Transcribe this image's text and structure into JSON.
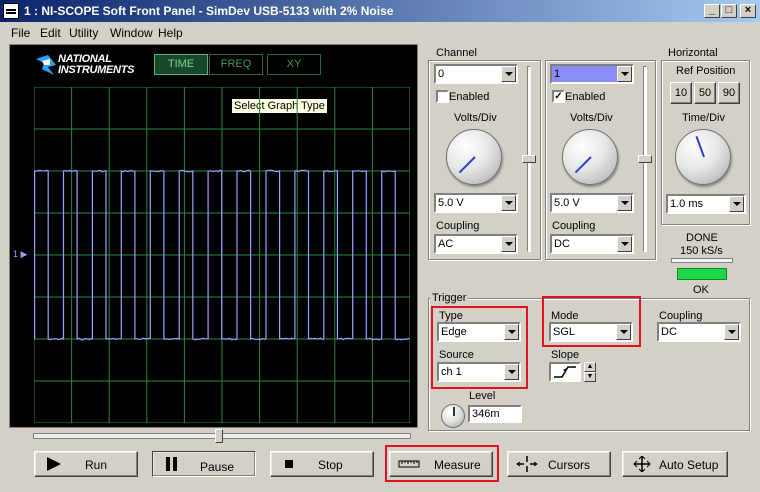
{
  "window": {
    "title": "1 : NI-SCOPE Soft Front Panel - SimDev USB-5133 with 2% Noise",
    "minimize": "_",
    "maximize": "□",
    "close": "×"
  },
  "menu": [
    "File",
    "Edit",
    "Utility",
    "Window",
    "Help"
  ],
  "graph": {
    "logo_line1": "NATIONAL",
    "logo_line2": "INSTRUMENTS",
    "tabs": [
      "TIME",
      "FREQ",
      "XY"
    ],
    "active_tab": "TIME",
    "tooltip": "Select Graph Type",
    "channel_marker": "1 ▶",
    "trace_color": "#9aa0ff",
    "grid_color": "#1f8a3e",
    "divisions": {
      "x": 10,
      "y": 8
    },
    "waveform": {
      "type": "square",
      "periods": 13,
      "high_level_div": 2.0,
      "low_level_div": -2.0,
      "duty": 0.47
    },
    "horizontal_scroll_fraction": 0.5
  },
  "channel": {
    "group_title": "Channel",
    "ch0": {
      "select": "0",
      "enabled_label": "Enabled",
      "enabled": false,
      "volts_label": "Volts/Div",
      "volts": "5.0 V",
      "coupling_label": "Coupling",
      "coupling": "AC",
      "offset_fraction": 0.5
    },
    "ch1": {
      "select": "1",
      "enabled_label": "Enabled",
      "enabled": true,
      "volts_label": "Volts/Div",
      "volts": "5.0 V",
      "coupling_label": "Coupling",
      "coupling": "DC",
      "offset_fraction": 0.5
    }
  },
  "horizontal": {
    "group_title": "Horizontal",
    "ref_label": "Ref Position",
    "ref_options": [
      "10",
      "50",
      "90"
    ],
    "time_label": "Time/Div",
    "time": "1.0 ms"
  },
  "status": {
    "state": "DONE",
    "rate": "150 kS/s",
    "ok": "OK",
    "led_color": "#1ed84a"
  },
  "trigger": {
    "group_title": "Trigger",
    "type_label": "Type",
    "type": "Edge",
    "source_label": "Source",
    "source": "ch 1",
    "level_label": "Level",
    "level": "346m",
    "mode_label": "Mode",
    "mode": "SGL",
    "slope_label": "Slope",
    "coupling_label": "Coupling",
    "coupling": "DC"
  },
  "actions": {
    "run": "Run",
    "pause": "Pause",
    "stop": "Stop",
    "measure": "Measure",
    "cursors": "Cursors",
    "auto_setup": "Auto Setup"
  },
  "highlight_color": "#e0141e"
}
